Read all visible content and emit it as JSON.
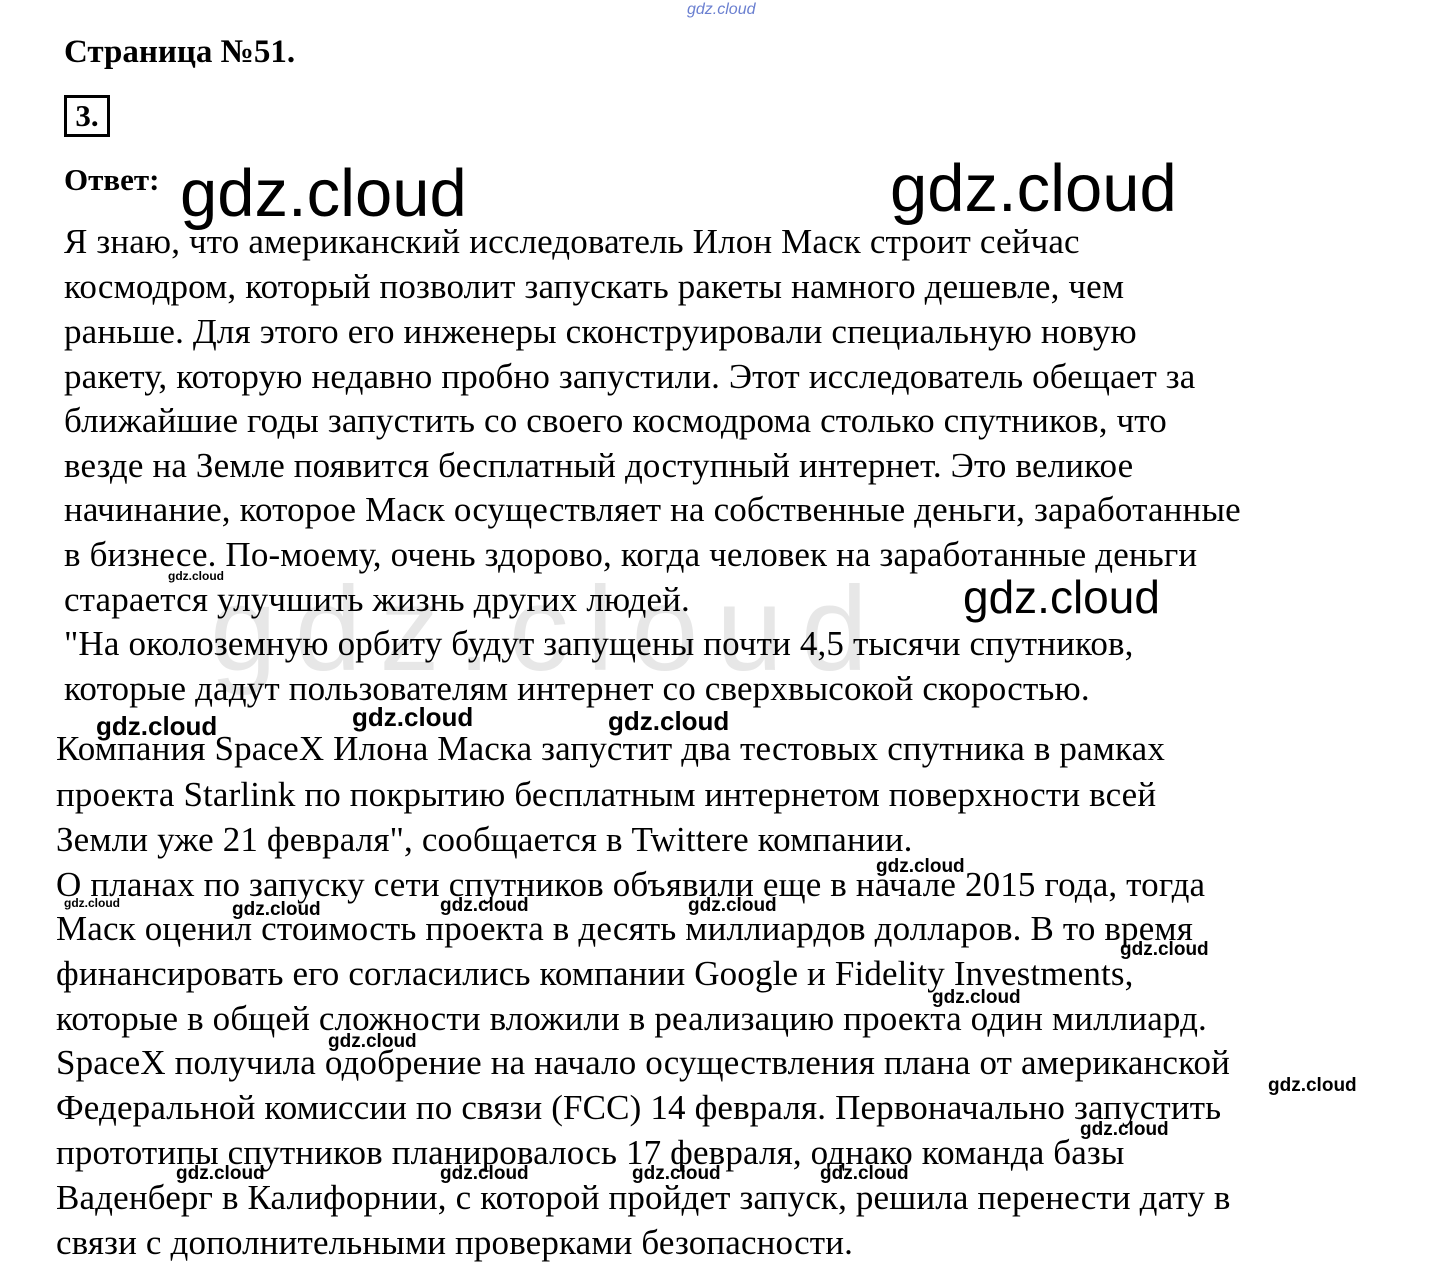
{
  "header": {
    "site_mark": "gdz.cloud",
    "page_title": "Страница №51.",
    "task_number": "3.",
    "answer_label": "Ответ:"
  },
  "body_lines": [
    "Я знаю, что американский исследователь Илон Маск строит сейчас",
    "космодром, который позволит запускать ракеты намного дешевле, чем",
    "раньше. Для этого его инженеры сконструировали специальную новую",
    "ракету, которую недавно пробно запустили. Этот исследователь обещает за",
    "ближайшие годы запустить со своего космодрома столько спутников, что",
    "везде на Земле появится бесплатный доступный интернет. Это великое",
    "начинание, которое Маск осуществляет на собственные деньги, заработанные",
    "в бизнесе. По-моему, очень здорово, когда человек на заработанные деньги",
    "старается улучшить жизнь других людей.",
    "\"На околоземную орбиту будут запущены почти 4,5 тысячи спутников,",
    "которые дадут пользователям интернет со сверхвысокой скоростью.",
    "Компания SpaceX Илона Маска запустит два тестовых спутника в рамках",
    "проекта Starlink по покрытию бесплатным интернетом поверхности всей",
    "Земли уже 21 февраля\", сообщается в Twittere компании.",
    "О планах по запуску сети спутников объявили еще в начале 2015 года, тогда",
    "Маск оценил стоимость проекта в десять миллиардов долларов. В то время",
    "финансировать его согласились компании Google и Fidelity Investments,",
    "которые в общей сложности вложили в реализацию проекта один миллиард.",
    "SpaceX получила одобрение на начало осуществления плана от американской",
    "Федеральной комиссии по связи (FCC) 14 февраля. Первоначально запустить",
    "прототипы спутников планировалось 17 февраля, однако команда базы",
    "Ваденберг в Калифорнии, с которой пройдет запуск, решила перенести дату в",
    "связи с дополнительными проверками безопасности."
  ],
  "watermarks": {
    "text": "gdz.cloud",
    "ghost_text": "gdz.cloud"
  }
}
